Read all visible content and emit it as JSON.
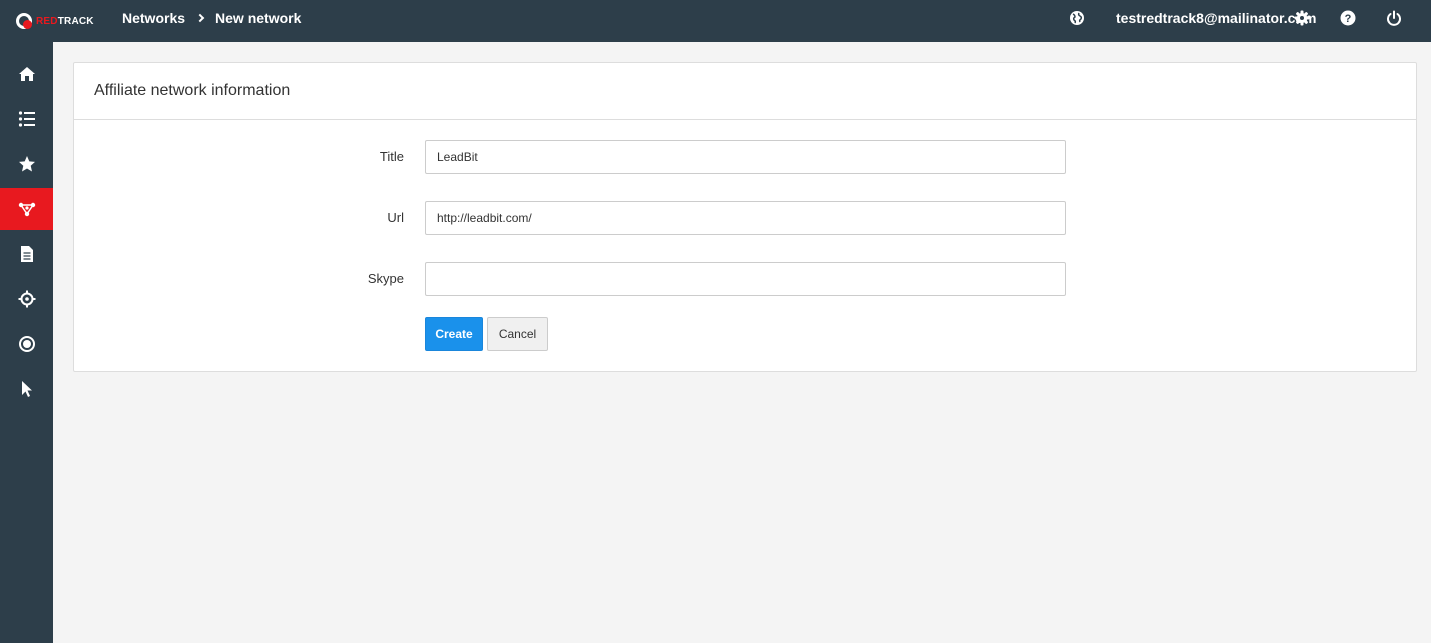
{
  "logo": {
    "red": "RED",
    "white": "TRACK"
  },
  "breadcrumb": {
    "parent": "Networks",
    "current": "New network"
  },
  "header": {
    "user_email": "testredtrack8@mailinator.com"
  },
  "sidebar": {
    "items": [
      {
        "icon": "home-icon",
        "active": false
      },
      {
        "icon": "list-icon",
        "active": false
      },
      {
        "icon": "star-icon",
        "active": false
      },
      {
        "icon": "network-icon",
        "active": true
      },
      {
        "icon": "document-icon",
        "active": false
      },
      {
        "icon": "target-icon",
        "active": false
      },
      {
        "icon": "record-icon",
        "active": false
      },
      {
        "icon": "cursor-icon",
        "active": false
      }
    ]
  },
  "panel": {
    "title": "Affiliate network information"
  },
  "form": {
    "title_label": "Title",
    "title_value": "LeadBit",
    "url_label": "Url",
    "url_value": "http://leadbit.com/",
    "skype_label": "Skype",
    "skype_value": "",
    "create_label": "Create",
    "cancel_label": "Cancel"
  },
  "colors": {
    "topbar": "#2d3e4a",
    "accent_red": "#e8191f",
    "primary_blue": "#1a91eb"
  }
}
